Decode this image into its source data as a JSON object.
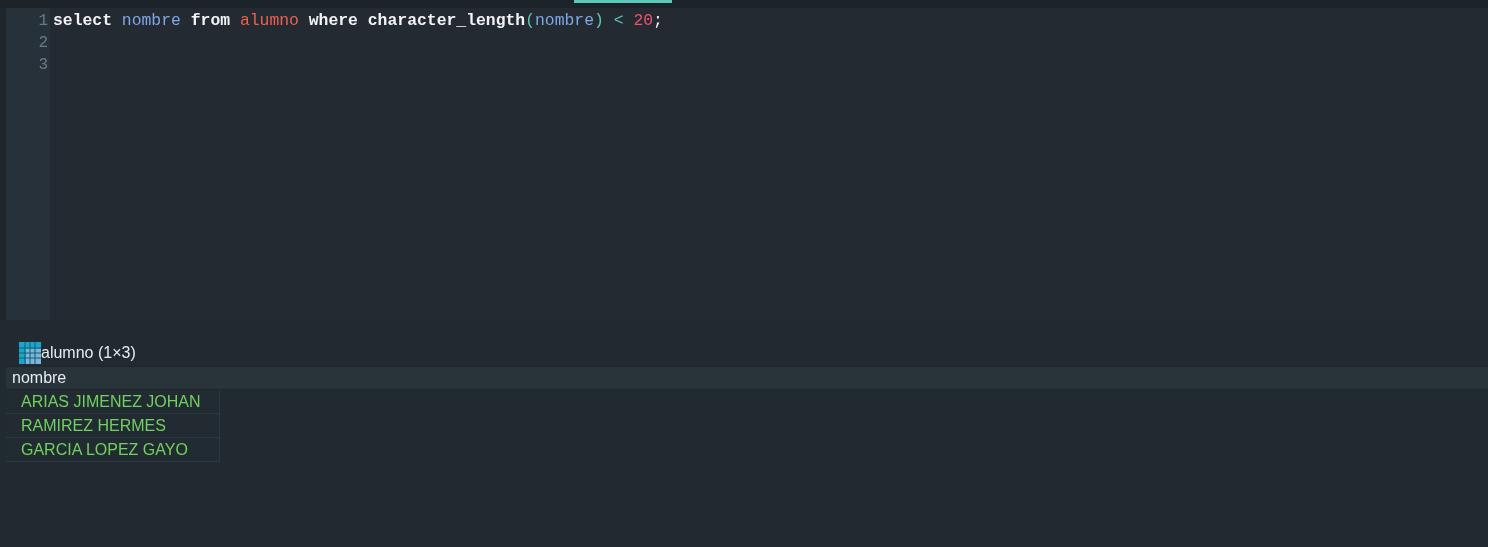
{
  "editor": {
    "lines": [
      {
        "number": "1",
        "tokens": [
          {
            "kind": "keyword",
            "text": "select"
          },
          {
            "kind": "column",
            "text": "nombre",
            "gap_before": true
          },
          {
            "kind": "keyword",
            "text": "from",
            "gap_before": true
          },
          {
            "kind": "table",
            "text": "alumno",
            "gap_before": true
          },
          {
            "kind": "keyword",
            "text": "where",
            "gap_before": true
          },
          {
            "kind": "function",
            "text": "character_length",
            "gap_before": true
          },
          {
            "kind": "paren",
            "text": "("
          },
          {
            "kind": "column",
            "text": "nombre"
          },
          {
            "kind": "paren",
            "text": ")"
          },
          {
            "kind": "operator",
            "text": "<",
            "gap_before": true
          },
          {
            "kind": "number",
            "text": "20",
            "gap_before": true
          },
          {
            "kind": "punct",
            "text": ";"
          }
        ]
      },
      {
        "number": "2"
      },
      {
        "number": "3"
      }
    ]
  },
  "result": {
    "title": "alumno (1×3)",
    "columns": [
      "nombre"
    ],
    "rows": [
      [
        "ARIAS JIMENEZ JOHAN"
      ],
      [
        "RAMIREZ HERMES"
      ],
      [
        "GARCIA LOPEZ GAYO"
      ]
    ]
  }
}
